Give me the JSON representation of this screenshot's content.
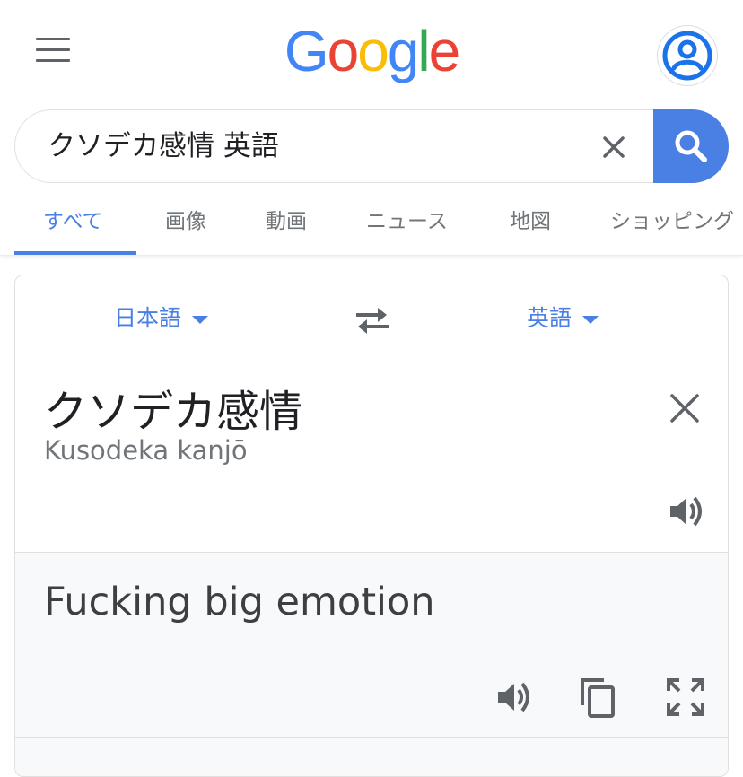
{
  "header": {
    "logo_text": "Google",
    "menu_icon": "hamburger-menu-icon",
    "account_icon": "account-circle-icon"
  },
  "search": {
    "query": "クソデカ感情 英語",
    "clear_icon": "close-icon",
    "search_icon": "search-icon"
  },
  "tabs": [
    {
      "label": "すべて",
      "active": true
    },
    {
      "label": "画像"
    },
    {
      "label": "動画"
    },
    {
      "label": "ニュース"
    },
    {
      "label": "地図"
    },
    {
      "label": "ショッピング"
    }
  ],
  "translate": {
    "source_lang": "日本語",
    "target_lang": "英語",
    "swap_icon": "swap-arrows-icon",
    "source_text": "クソデカ感情",
    "romanization": "Kusodeka kanjō",
    "translation": "Fucking big emotion",
    "icons": [
      "close-icon",
      "speaker-icon",
      "copy-icon",
      "fullscreen-icon"
    ]
  },
  "colors": {
    "accent": "#4a7fe4",
    "text_primary": "#202124",
    "text_secondary": "#70757a",
    "result_bg": "#f8f9fa"
  }
}
